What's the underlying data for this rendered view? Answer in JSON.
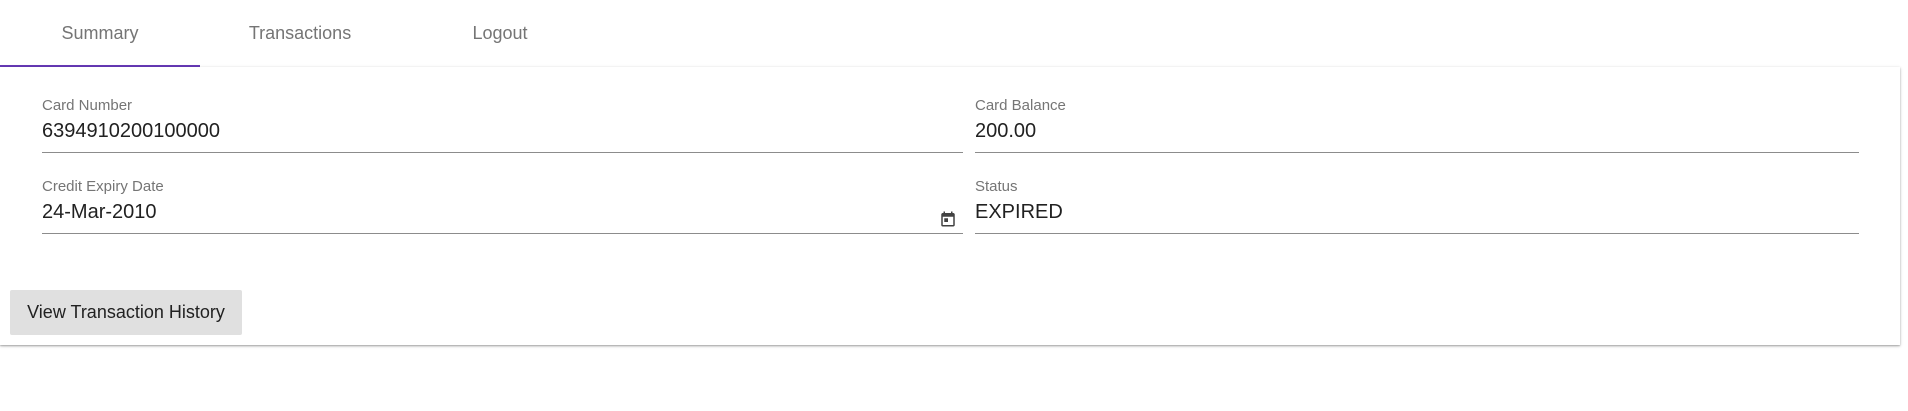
{
  "tabs": [
    {
      "label": "Summary",
      "active": true
    },
    {
      "label": "Transactions",
      "active": false
    },
    {
      "label": "Logout",
      "active": false
    }
  ],
  "fields": {
    "card_number": {
      "label": "Card Number",
      "value": "6394910200100000"
    },
    "card_balance": {
      "label": "Card Balance",
      "value": "200.00"
    },
    "credit_expiry_date": {
      "label": "Credit Expiry Date",
      "value": "24-Mar-2010"
    },
    "status": {
      "label": "Status",
      "value": "EXPIRED"
    }
  },
  "actions": {
    "view_history_label": "View Transaction History"
  },
  "colors": {
    "accent": "#673ab7",
    "button_bg": "#e0e0e0",
    "label": "#757575",
    "underline": "#8c8c8c"
  },
  "icons": {
    "date_picker": "calendar-icon"
  }
}
